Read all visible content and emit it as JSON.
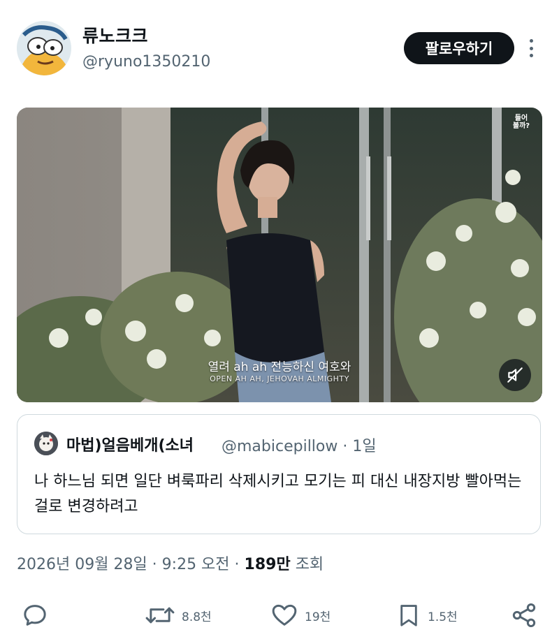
{
  "author": {
    "display_name": "류노크크",
    "handle": "@ryuno1350210",
    "follow_label": "팔로우하기"
  },
  "media": {
    "subtitle_primary": "열려 ah ah 전능하신 여호와",
    "subtitle_secondary": "OPEN AH AH, JEHOVAH ALMIGHTY",
    "watermark": "들어\n볼까?"
  },
  "quoted": {
    "display_name": "마법)얼음베개(소녀",
    "handle_and_time": "@mabicepillow · 1일",
    "text": "나 하느님 되면 일단 벼룩파리 삭제시키고 모기는 피 대신 내장지방 빨아먹는걸로 변경하려고"
  },
  "meta": {
    "date_time": "2026년 09월 28일 · 9:25 오전",
    "separator": " · ",
    "views_count": "189만",
    "views_label": " 조회"
  },
  "actions": {
    "reply": "",
    "repost": "8.8천",
    "like": "19천",
    "bookmark": "1.5천"
  },
  "colors": {
    "text": "#0f1419",
    "secondary": "#536471",
    "border": "#cfd9de",
    "follow_bg": "#0f1419"
  }
}
